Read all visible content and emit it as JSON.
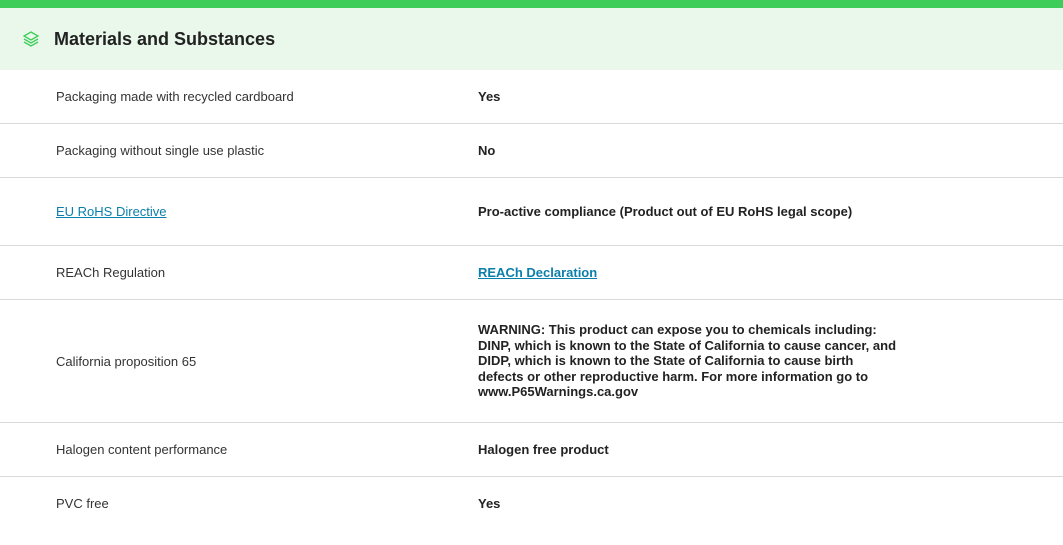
{
  "section": {
    "title": "Materials and Substances",
    "accent_color": "#3dcd58",
    "header_bg": "#e9f8ea",
    "icon": "layers-icon"
  },
  "rows": [
    {
      "label": "Packaging made with recycled cardboard",
      "value": "Yes"
    },
    {
      "label": "Packaging without single use plastic",
      "value": "No"
    },
    {
      "label": "EU RoHS Directive",
      "value": "Pro-active compliance (Product out of EU RoHS legal scope)"
    },
    {
      "label": "REACh Regulation",
      "value": "REACh Declaration"
    },
    {
      "label": "California proposition 65",
      "value": "WARNING: This product can expose you to chemicals including: DINP, which is known to the State of California to cause cancer, and DIDP, which is known to the State of California to cause birth defects or other reproductive harm. For more information go to www.P65Warnings.ca.gov"
    },
    {
      "label": "Halogen content performance",
      "value": "Halogen free product"
    },
    {
      "label": "PVC free",
      "value": "Yes"
    }
  ],
  "link_color": "#0b7fab"
}
